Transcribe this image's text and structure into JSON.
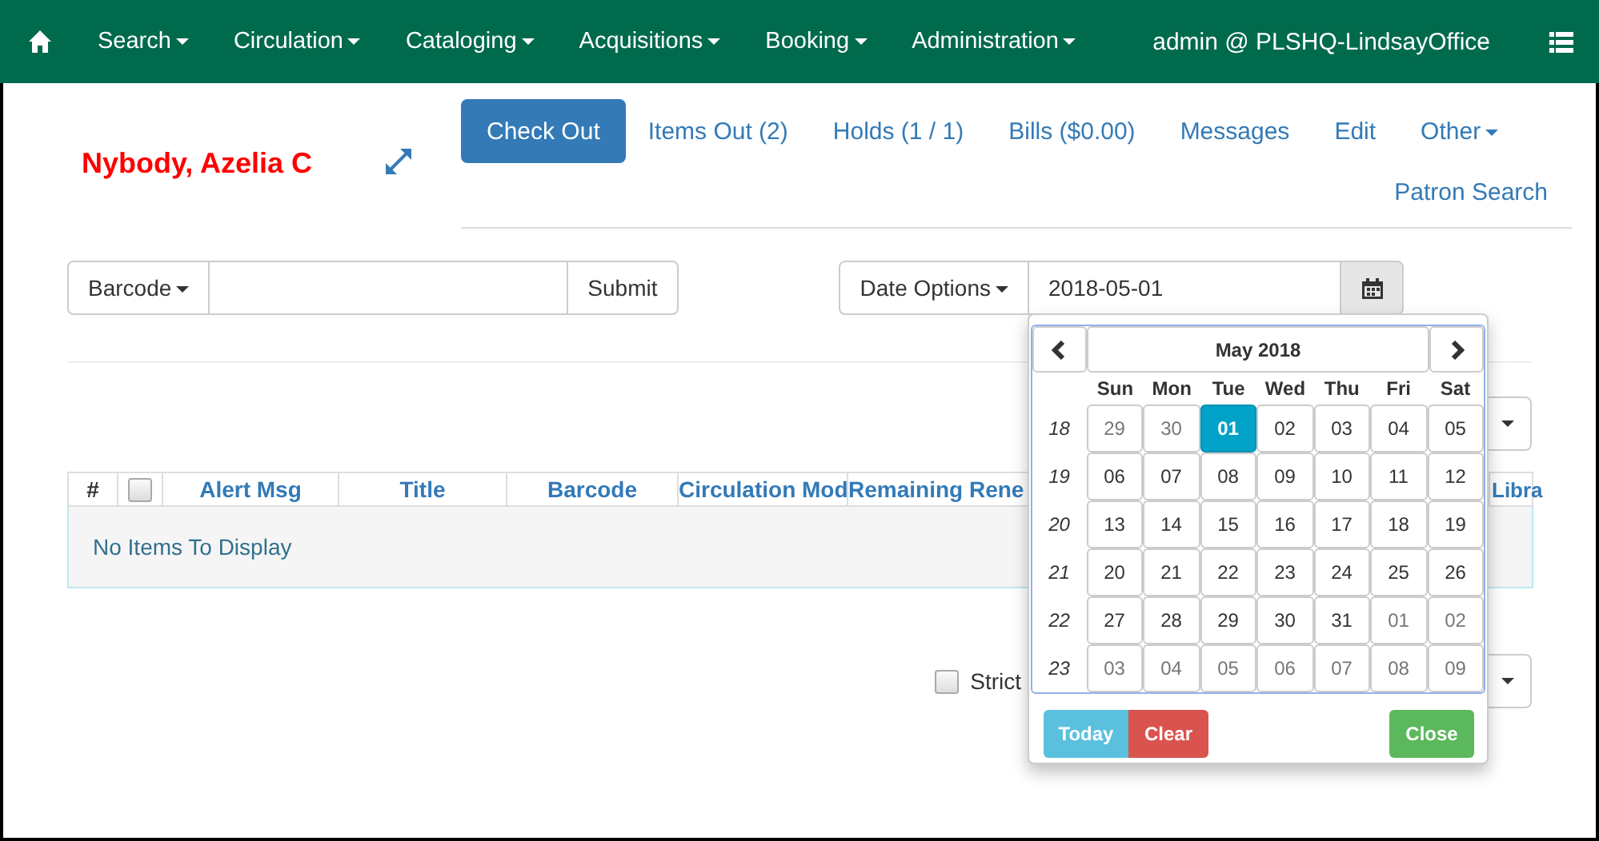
{
  "nav": {
    "items": [
      {
        "label": "Search"
      },
      {
        "label": "Circulation"
      },
      {
        "label": "Cataloging"
      },
      {
        "label": "Acquisitions"
      },
      {
        "label": "Booking"
      },
      {
        "label": "Administration"
      }
    ],
    "user": "admin @ PLSHQ-LindsayOffice"
  },
  "patron": {
    "name": "Nybody, Azelia C"
  },
  "tabs": [
    {
      "label": "Check Out",
      "selected": true,
      "kind": "tab"
    },
    {
      "label": "Items Out (2)",
      "selected": false,
      "kind": "tab"
    },
    {
      "label": "Holds (1 / 1)",
      "selected": false,
      "kind": "tab"
    },
    {
      "label": "Bills ($0.00)",
      "selected": false,
      "kind": "tab"
    },
    {
      "label": "Messages",
      "selected": false,
      "kind": "tab"
    },
    {
      "label": "Edit",
      "selected": false,
      "kind": "tab"
    },
    {
      "label": "Other",
      "selected": false,
      "kind": "dropdown"
    }
  ],
  "patron_search": "Patron Search",
  "checkout": {
    "barcode_menu": "Barcode",
    "submit": "Submit",
    "date_options": "Date Options",
    "date": "2018-05-01"
  },
  "table": {
    "columns": [
      {
        "kind": "text",
        "label": "#"
      },
      {
        "kind": "checkbox",
        "checked": false
      },
      {
        "kind": "text",
        "label": "Alert Msg"
      },
      {
        "kind": "text",
        "label": "Title"
      },
      {
        "kind": "text",
        "label": "Barcode"
      },
      {
        "kind": "text",
        "label": "Circulation Mod"
      },
      {
        "kind": "text",
        "label": "Remaining Rene"
      },
      {
        "kind": "text",
        "label": "Libra"
      }
    ],
    "empty_message": "No Items To Display"
  },
  "strict": {
    "label": "Strict",
    "checked": false
  },
  "datepicker": {
    "title": "May 2018",
    "weekdays": [
      "Sun",
      "Mon",
      "Tue",
      "Wed",
      "Thu",
      "Fri",
      "Sat"
    ],
    "weeks": [
      {
        "number": "18",
        "days": [
          {
            "label": "29",
            "muted": true,
            "selected": false
          },
          {
            "label": "30",
            "muted": true,
            "selected": false
          },
          {
            "label": "01",
            "muted": false,
            "selected": true
          },
          {
            "label": "02",
            "muted": false,
            "selected": false
          },
          {
            "label": "03",
            "muted": false,
            "selected": false
          },
          {
            "label": "04",
            "muted": false,
            "selected": false
          },
          {
            "label": "05",
            "muted": false,
            "selected": false
          }
        ]
      },
      {
        "number": "19",
        "days": [
          {
            "label": "06",
            "muted": false,
            "selected": false
          },
          {
            "label": "07",
            "muted": false,
            "selected": false
          },
          {
            "label": "08",
            "muted": false,
            "selected": false
          },
          {
            "label": "09",
            "muted": false,
            "selected": false
          },
          {
            "label": "10",
            "muted": false,
            "selected": false
          },
          {
            "label": "11",
            "muted": false,
            "selected": false
          },
          {
            "label": "12",
            "muted": false,
            "selected": false
          }
        ]
      },
      {
        "number": "20",
        "days": [
          {
            "label": "13",
            "muted": false,
            "selected": false
          },
          {
            "label": "14",
            "muted": false,
            "selected": false
          },
          {
            "label": "15",
            "muted": false,
            "selected": false
          },
          {
            "label": "16",
            "muted": false,
            "selected": false
          },
          {
            "label": "17",
            "muted": false,
            "selected": false
          },
          {
            "label": "18",
            "muted": false,
            "selected": false
          },
          {
            "label": "19",
            "muted": false,
            "selected": false
          }
        ]
      },
      {
        "number": "21",
        "days": [
          {
            "label": "20",
            "muted": false,
            "selected": false
          },
          {
            "label": "21",
            "muted": false,
            "selected": false
          },
          {
            "label": "22",
            "muted": false,
            "selected": false
          },
          {
            "label": "23",
            "muted": false,
            "selected": false
          },
          {
            "label": "24",
            "muted": false,
            "selected": false
          },
          {
            "label": "25",
            "muted": false,
            "selected": false
          },
          {
            "label": "26",
            "muted": false,
            "selected": false
          }
        ]
      },
      {
        "number": "22",
        "days": [
          {
            "label": "27",
            "muted": false,
            "selected": false
          },
          {
            "label": "28",
            "muted": false,
            "selected": false
          },
          {
            "label": "29",
            "muted": false,
            "selected": false
          },
          {
            "label": "30",
            "muted": false,
            "selected": false
          },
          {
            "label": "31",
            "muted": false,
            "selected": false
          },
          {
            "label": "01",
            "muted": true,
            "selected": false
          },
          {
            "label": "02",
            "muted": true,
            "selected": false
          }
        ]
      },
      {
        "number": "23",
        "days": [
          {
            "label": "03",
            "muted": true,
            "selected": false
          },
          {
            "label": "04",
            "muted": true,
            "selected": false
          },
          {
            "label": "05",
            "muted": true,
            "selected": false
          },
          {
            "label": "06",
            "muted": true,
            "selected": false
          },
          {
            "label": "07",
            "muted": true,
            "selected": false
          },
          {
            "label": "08",
            "muted": true,
            "selected": false
          },
          {
            "label": "09",
            "muted": true,
            "selected": false
          }
        ]
      }
    ],
    "buttons": [
      {
        "label": "Today",
        "kind": "info"
      },
      {
        "label": "Clear",
        "kind": "danger"
      },
      {
        "label": "Close",
        "kind": "success"
      }
    ]
  }
}
